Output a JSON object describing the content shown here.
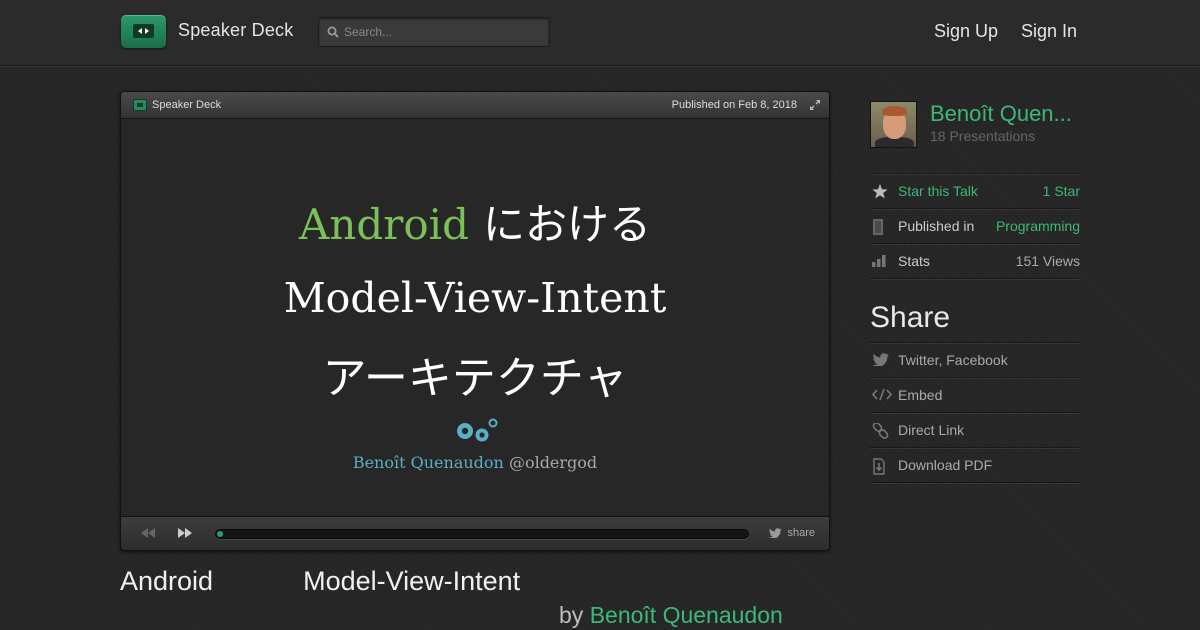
{
  "header": {
    "brand": "Speaker Deck",
    "search_placeholder": "Search...",
    "nav": {
      "sign_up": "Sign Up",
      "sign_in": "Sign In"
    }
  },
  "player": {
    "brand": "Speaker Deck",
    "published": "Published on Feb 8, 2018",
    "slide": {
      "line1_green": "Android",
      "line1_rest": "における",
      "line2": "Model-View-Intent",
      "line3": "アーキテクチャ",
      "author": "Benoît Quenaudon",
      "handle": "@oldergod"
    },
    "controls": {
      "share": "share",
      "progress_percent": 1
    }
  },
  "talk": {
    "title": "Android            Model-View-Intent",
    "by": "by",
    "author": "Benoît Quenaudon"
  },
  "sidebar": {
    "author_name": "Benoît Quen...",
    "presentations": "18 Presentations",
    "rows": [
      {
        "icon": "star-icon",
        "label": "Star this Talk",
        "value": "1 Star"
      },
      {
        "icon": "bookmark-icon",
        "label": "Published in",
        "value": "Programming"
      },
      {
        "icon": "stats-icon",
        "label": "Stats",
        "value": "151 Views"
      }
    ],
    "share_title": "Share",
    "share_items": [
      {
        "icon": "twitter-icon",
        "label": "Twitter, Facebook"
      },
      {
        "icon": "embed-icon",
        "label": "Embed"
      },
      {
        "icon": "link-icon",
        "label": "Direct Link"
      },
      {
        "icon": "download-icon",
        "label": "Download PDF"
      }
    ]
  },
  "colors": {
    "accent": "#3db87a",
    "android_green": "#7cc05a",
    "author_blue": "#5aaec5"
  }
}
